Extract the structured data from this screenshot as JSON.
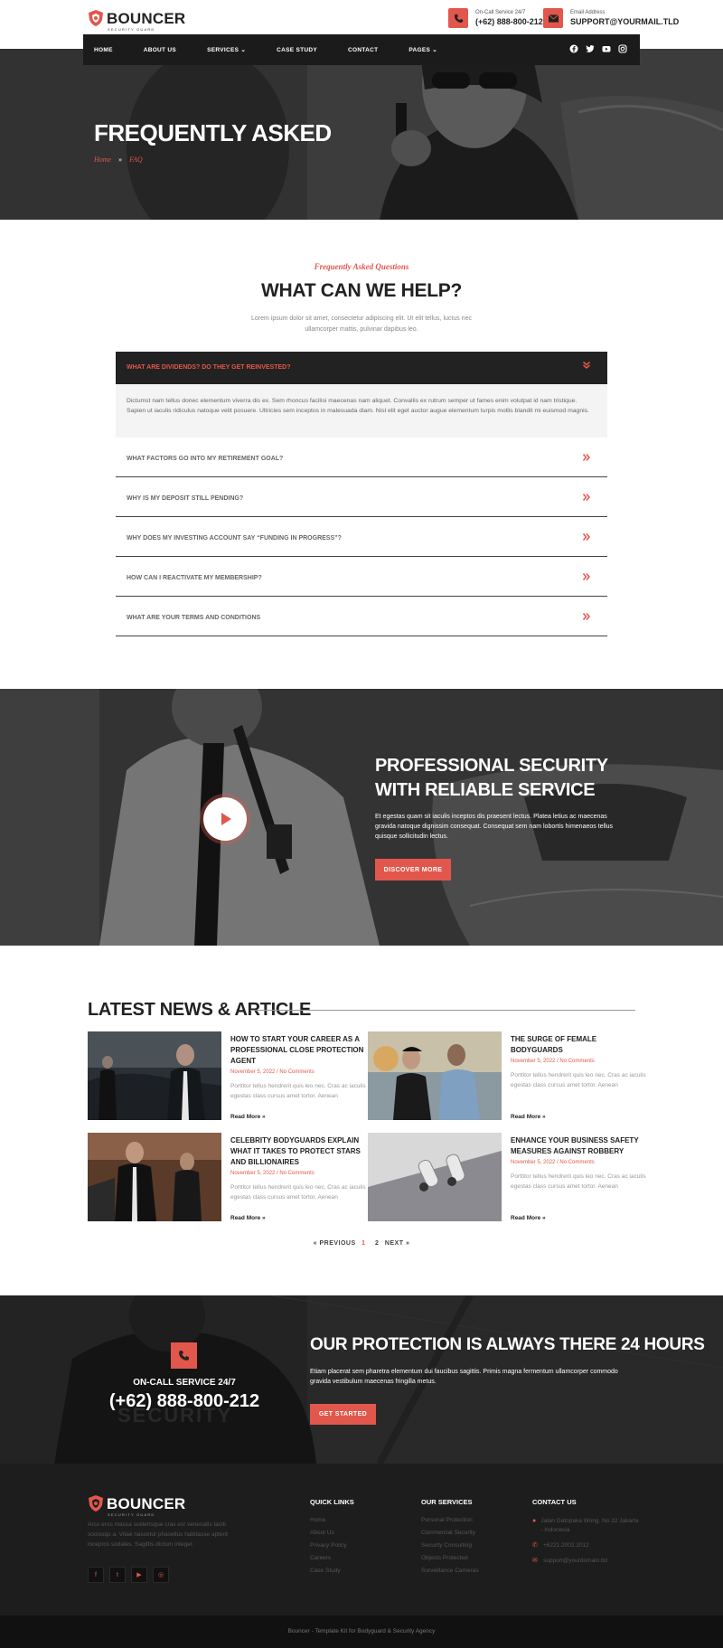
{
  "header": {
    "brand": "BOUNCER",
    "tagline": "SECURITY GUARD",
    "service_label": "On-Call Service 24/7",
    "service_value": "(+62) 888-800-212",
    "email_label": "Email Address",
    "email_value": "SUPPORT@YOURMAIL.TLD"
  },
  "nav": {
    "items": [
      {
        "label": "HOME"
      },
      {
        "label": "ABOUT US"
      },
      {
        "label": "SERVICES"
      },
      {
        "label": "CASE STUDY"
      },
      {
        "label": "CONTACT"
      },
      {
        "label": "PAGES"
      }
    ],
    "dropdown_icon": "chevron-down-icon",
    "socials": [
      "facebook-icon",
      "twitter-icon",
      "youtube-icon",
      "instagram-icon"
    ]
  },
  "hero": {
    "title": "FREQUENTLY ASKED",
    "crumb_home": "Home",
    "crumb_sep": "»",
    "crumb_current": "FAQ"
  },
  "faq": {
    "subtitle": "Frequently Asked Questions",
    "title": "WHAT CAN WE HELP?",
    "description": "Lorem ipsum dolor sit amet, consectetur adipiscing elit. Ut elit tellus, luctus nec ullamcorper mattis, pulvinar dapibus leo.",
    "open_question": "WHAT ARE DIVIDENDS? DO THEY GET REINVESTED?",
    "open_answer": "Dictumst nam tellus donec elementum viverra dis ex. Sem rhoncus facilisi maecenas nam aliquet. Convallis ex rutrum semper ut fames enim volutpat id nam tristique. Sapien ut iaculis ridiculus natoque velit posuere. Ultricies sem inceptos in malesuada diam. Nisl elit eget auctor augue elementum turpis mollis blandit mi euismod magnis.",
    "questions": [
      "WHAT FACTORS GO INTO MY RETIREMENT GOAL?",
      "WHY IS MY DEPOSIT STILL PENDING?",
      "WHY DOES MY INVESTING ACCOUNT SAY “FUNDING IN PROGRESS”?",
      "HOW CAN I REACTIVATE MY MEMBERSHIP?",
      "WHAT ARE YOUR TERMS AND CONDITIONS"
    ],
    "open_chevron": "double-chevron-down-icon",
    "closed_chevron": "double-chevron-right-icon"
  },
  "video_section": {
    "title": "PROFESSIONAL SECURITY WITH RELIABLE SERVICE",
    "text": "Et egestas quam sit iaculis inceptos dis praesent lectus. Platea letius ac maecenas gravida natoque dignissim consequat. Consequat sem nam lobortis himenaeos tellus quisque sollicitudin lectus.",
    "button": "DISCOVER MORE"
  },
  "news": {
    "title": "LATEST NEWS & ARTICLE",
    "read_more": "Read More »",
    "articles": [
      {
        "title": "HOW TO START YOUR CAREER AS A PROFESSIONAL CLOSE PROTECTION AGENT",
        "date": "November 5, 2022",
        "comments": "No Comments",
        "excerpt": "Porttitor tellus hendrerit quis leo nec. Cras ac iaculis egestas class cursus amet tortor. Aenean"
      },
      {
        "title": "THE SURGE OF FEMALE BODYGUARDS",
        "date": "November 5, 2022",
        "comments": "No Comments",
        "excerpt": "Porttitor tellus hendrerit quis leo nec. Cras ac iaculis egestas class cursus amet tortor. Aenean"
      },
      {
        "title": "CELEBRITY BODYGUARDS EXPLAIN WHAT IT TAKES TO PROTECT STARS AND BILLIONAIRES",
        "date": "November 5, 2022",
        "comments": "No Comments",
        "excerpt": "Porttitor tellus hendrerit quis leo nec. Cras ac iaculis egestas class cursus amet tortor. Aenean"
      },
      {
        "title": "ENHANCE YOUR BUSINESS SAFETY MEASURES AGAINST ROBBERY",
        "date": "November 5, 2022",
        "comments": "No Comments",
        "excerpt": "Porttitor tellus hendrerit quis leo nec. Cras ac iaculis egestas class cursus amet tortor. Aenean"
      }
    ],
    "pager": {
      "prev": "« PREVIOUS",
      "pages": [
        "1",
        "2"
      ],
      "current": "1",
      "next": "NEXT »"
    }
  },
  "cta": {
    "oncall": "ON-CALL SERVICE 24/7",
    "phone": "(+62) 888-800-212",
    "title": "OUR PROTECTION IS ALWAYS THERE 24 HOURS",
    "text": "Etiam placerat sem pharetra elementum dui faucibus sagittis. Primis magna fermentum ullamcorper commodo gravida vestibulum maecenas fringilla metus.",
    "button": "GET STARTED"
  },
  "footer": {
    "brand": "BOUNCER",
    "tagline": "SECURITY GUARD",
    "description": "Arcu eros massa scelerisque cras est venenatis taciti sociosqu a. Vitae nascetur phasellus habitasse aptent inceptos sodales. Sagittis dictum integer.",
    "quick_links_title": "QUICK LINKS",
    "quick_links": [
      "Home",
      "About Us",
      "Privacy Policy",
      "Careers",
      "Case Study"
    ],
    "services_title": "OUR SERVICES",
    "services": [
      "Personal Protection",
      "Commercial Security",
      "Security Consulting",
      "Objects Protected",
      "Surveillance Cameras"
    ],
    "contact_title": "CONTACT US",
    "contact": [
      {
        "icon": "map-pin-icon",
        "text": "Jalan Gatopaka Wong. No 22 Jakarta - Indonesia"
      },
      {
        "icon": "phone-icon",
        "text": "+6221.2002.2012"
      },
      {
        "icon": "envelope-icon",
        "text": "support@yourdomain.tld"
      }
    ],
    "copyright": "Bouncer - Template Kit for Bodyguard & Security Agency"
  },
  "colors": {
    "accent": "#e2574c",
    "dark": "#1d1d1d"
  }
}
